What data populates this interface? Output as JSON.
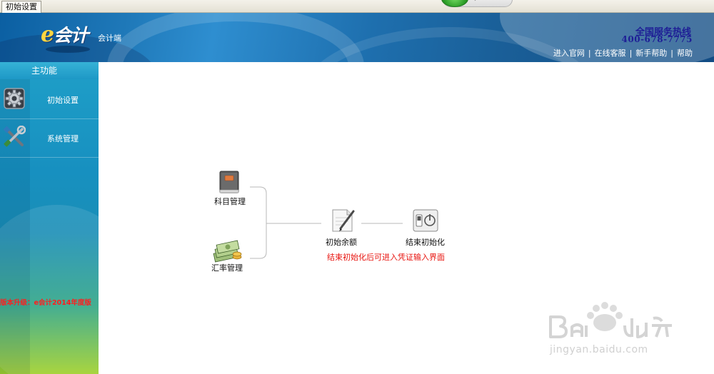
{
  "tabbar": {
    "tab_label": "初始设置"
  },
  "header": {
    "app_name": "会计",
    "subtitle": "会计端",
    "hotline_title": "全国服务热线",
    "hotline_number": "400-678-7775",
    "links": [
      "进入官网",
      "在线客服",
      "新手帮助",
      "帮助"
    ],
    "link_separator": "|"
  },
  "sidebar": {
    "title": "主功能",
    "items": [
      {
        "label": "初始设置",
        "icon": "gear-icon"
      },
      {
        "label": "系统管理",
        "icon": "tools-icon"
      }
    ],
    "upgrade_notice": "版本升级：e会计2014年度版"
  },
  "flow": {
    "nodes": [
      {
        "label": "科目管理",
        "icon": "ledger-book-icon"
      },
      {
        "label": "汇率管理",
        "icon": "money-stack-icon"
      },
      {
        "label": "初始余额",
        "icon": "document-pen-icon"
      },
      {
        "label": "结束初始化",
        "icon": "power-switch-icon"
      }
    ],
    "hint": "结束初始化后可进入凭证输入界面"
  },
  "watermark": {
    "url": "jingyan.baidu.com"
  },
  "colors": {
    "banner_blue": "#1f79b9",
    "hotline_text": "#1e1e96",
    "hint_red": "#e8140f",
    "upgrade_red": "#ff1e1e"
  }
}
